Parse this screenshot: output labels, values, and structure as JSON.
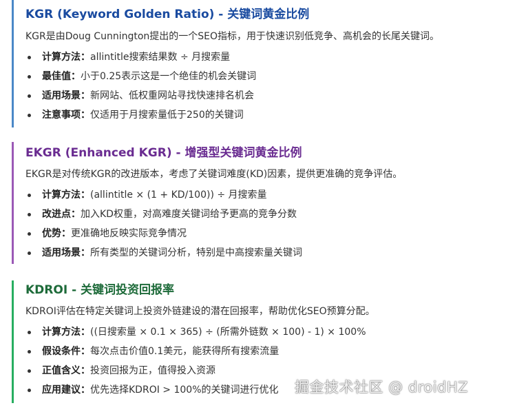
{
  "sections": [
    {
      "title": "KGR (Keyword Golden Ratio) - 关键词黄金比例",
      "desc": "KGR是由Doug Cunnington提出的一个SEO指标，用于快速识别低竞争、高机会的长尾关键词。",
      "items": [
        {
          "label": "计算方法：",
          "text": "allintitle搜索结果数 ÷ 月搜索量"
        },
        {
          "label": "最佳值：",
          "text": "小于0.25表示这是一个绝佳的机会关键词"
        },
        {
          "label": "适用场景：",
          "text": "新网站、低权重网站寻找快速排名机会"
        },
        {
          "label": "注意事项：",
          "text": "仅适用于月搜索量低于250的关键词"
        }
      ]
    },
    {
      "title": "EKGR (Enhanced KGR) - 增强型关键词黄金比例",
      "desc": "EKGR是对传统KGR的改进版本，考虑了关键词难度(KD)因素，提供更准确的竞争评估。",
      "items": [
        {
          "label": "计算方法：",
          "text": "(allintitle × (1 + KD/100)) ÷ 月搜索量"
        },
        {
          "label": "改进点：",
          "text": "加入KD权重，对高难度关键词给予更高的竞争分数"
        },
        {
          "label": "优势：",
          "text": "更准确地反映实际竞争情况"
        },
        {
          "label": "适用场景：",
          "text": "所有类型的关键词分析，特别是中高搜索量关键词"
        }
      ]
    },
    {
      "title": "KDROI - 关键词投资回报率",
      "desc": "KDROI评估在特定关键词上投资外链建设的潜在回报率，帮助优化SEO预算分配。",
      "items": [
        {
          "label": "计算方法：",
          "text": "((日搜索量 × 0.1 × 365) ÷ (所需外链数 × 100) - 1) × 100%"
        },
        {
          "label": "假设条件：",
          "text": "每次点击价值0.1美元，能获得所有搜索流量"
        },
        {
          "label": "正值含义：",
          "text": "投资回报为正，值得投入资源"
        },
        {
          "label": "应用建议：",
          "text": "优先选择KDROI > 100%的关键词进行优化"
        }
      ]
    }
  ],
  "watermark": "掘金技术社区 @ droidHZ",
  "colors": {
    "kgr_accent": "#4a88c7",
    "ekgr_accent": "#9b59b6",
    "kdroi_accent": "#27ae60",
    "kgr_title": "#1a4ba0",
    "ekgr_title": "#6a2c91",
    "kdroi_title": "#1e6b3a"
  }
}
